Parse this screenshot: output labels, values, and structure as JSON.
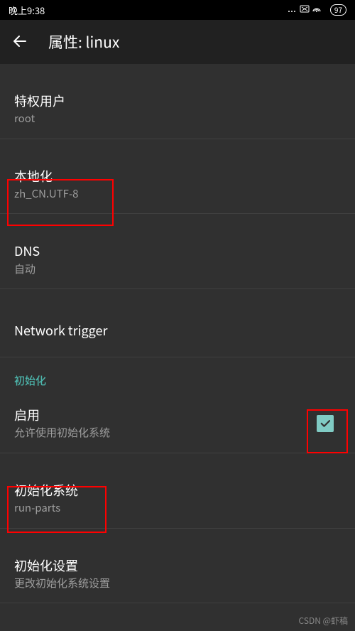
{
  "statusbar": {
    "time": "晚上9:38",
    "icons": "...  ⊠ ⊗",
    "battery": "97"
  },
  "header": {
    "title": "属性: linux"
  },
  "settings": {
    "privileged": {
      "title": "特权用户",
      "subtitle": "root"
    },
    "locale": {
      "title": "本地化",
      "subtitle": "zh_CN.UTF-8"
    },
    "dns": {
      "title": "DNS",
      "subtitle": "自动"
    },
    "network_trigger": {
      "title": "Network trigger"
    }
  },
  "section": {
    "init": "初始化"
  },
  "init": {
    "enable": {
      "title": "启用",
      "subtitle": "允许使用初始化系统",
      "checked": true
    },
    "system": {
      "title": "初始化系统",
      "subtitle": "run-parts"
    },
    "settings": {
      "title": "初始化设置",
      "subtitle": "更改初始化系统设置"
    }
  },
  "watermark": "CSDN @虾稿"
}
